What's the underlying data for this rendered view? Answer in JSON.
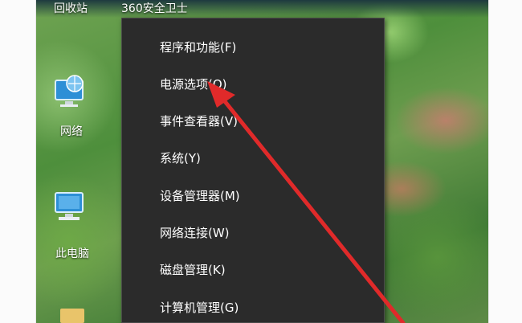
{
  "desktop": {
    "top_labels": [
      "回收站",
      "360安全卫士"
    ],
    "icons": [
      {
        "label": "网络",
        "icon": "network-icon"
      },
      {
        "label": "此电脑",
        "icon": "computer-icon"
      }
    ]
  },
  "context_menu": {
    "items": [
      "程序和功能(F)",
      "电源选项(O)",
      "事件查看器(V)",
      "系统(Y)",
      "设备管理器(M)",
      "网络连接(W)",
      "磁盘管理(K)",
      "计算机管理(G)"
    ]
  },
  "annotation": {
    "color": "#e02a2a",
    "points_to": "电源选项(O)"
  }
}
